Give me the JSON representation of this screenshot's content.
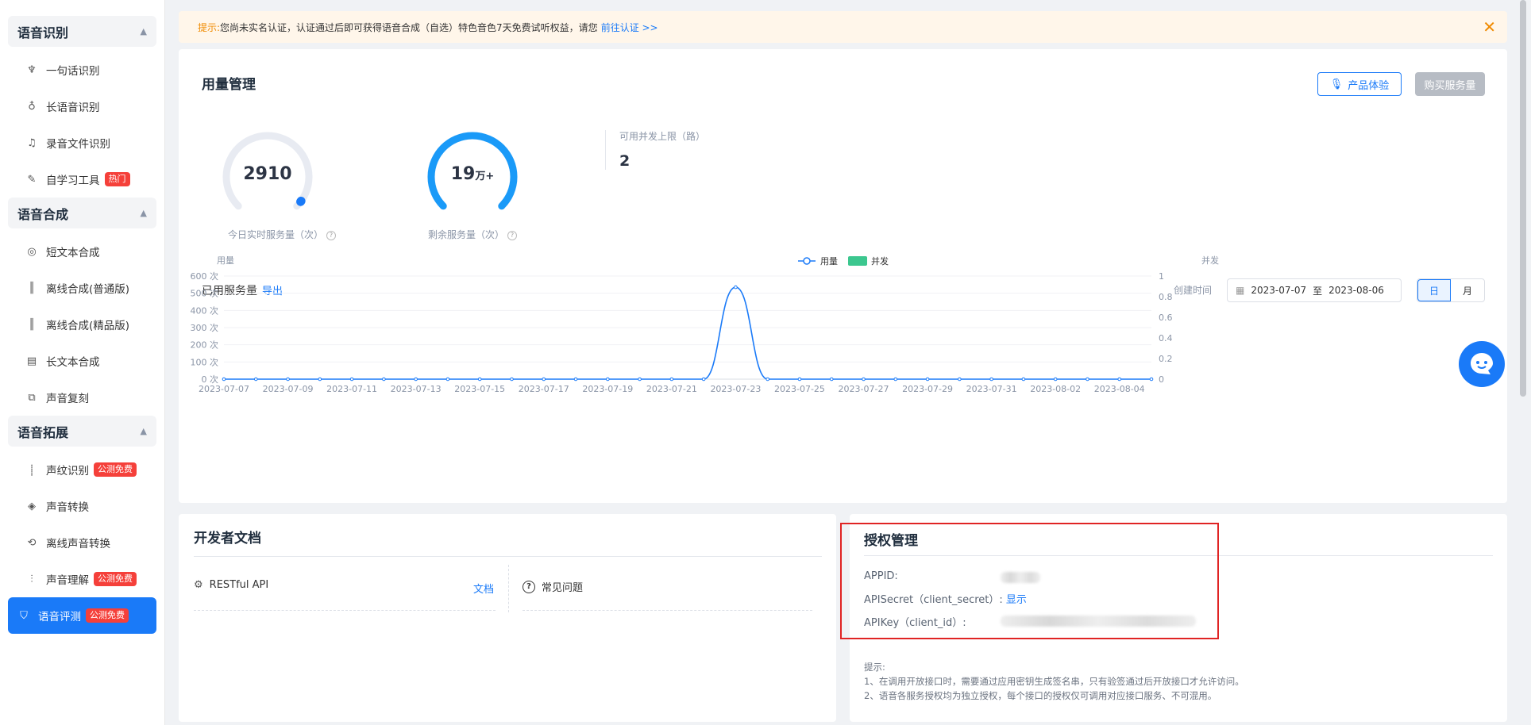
{
  "sidebar": {
    "groups": [
      {
        "title": "语音识别",
        "items": [
          {
            "label": "一句话识别",
            "icon": "mic-icon"
          },
          {
            "label": "长语音识别",
            "icon": "long-mic-icon"
          },
          {
            "label": "录音文件识别",
            "icon": "file-audio-icon"
          },
          {
            "label": "自学习工具",
            "icon": "edit-icon",
            "badge": "热门"
          }
        ]
      },
      {
        "title": "语音合成",
        "items": [
          {
            "label": "短文本合成",
            "icon": "synth-icon"
          },
          {
            "label": "离线合成(普通版)",
            "icon": "waveform-icon"
          },
          {
            "label": "离线合成(精品版)",
            "icon": "waveform-icon"
          },
          {
            "label": "长文本合成",
            "icon": "document-icon"
          },
          {
            "label": "声音复刻",
            "icon": "clone-icon"
          }
        ]
      },
      {
        "title": "语音拓展",
        "items": [
          {
            "label": "声纹识别",
            "icon": "voiceprint-icon",
            "badge": "公测免费"
          },
          {
            "label": "声音转换",
            "icon": "convert-icon"
          },
          {
            "label": "离线声音转换",
            "icon": "offline-convert-icon"
          },
          {
            "label": "声音理解",
            "icon": "understand-icon",
            "badge": "公测免费"
          },
          {
            "label": "语音评测",
            "icon": "shield-icon",
            "badge": "公测免费",
            "active": true
          }
        ]
      }
    ]
  },
  "notice": {
    "tip": "提示:",
    "text": "您尚未实名认证，认证通过后即可获得语音合成（自选）特色音色7天免费试听权益，请您",
    "link": "前往认证 >>"
  },
  "usage": {
    "title": "用量管理",
    "btn_try": "产品体验",
    "btn_buy": "购买服务量",
    "today_value": "2910",
    "today_label": "今日实时服务量（次）",
    "today_fraction": 0.97,
    "remaining_value": "19",
    "remaining_unit": "万+",
    "remaining_label": "剩余服务量（次）",
    "remaining_fraction": 1.0,
    "limit_label": "可用并发上限（路）",
    "limit_value": "2",
    "used_title": "已用服务量",
    "export": "导出",
    "date_label": "创建时间",
    "date_start": "2023-07-07",
    "date_sep": "至",
    "date_end": "2023-08-06",
    "seg_day": "日",
    "seg_month": "月"
  },
  "chart_data": {
    "type": "line",
    "ylabel_left": "用量",
    "ylabel_right": "并发",
    "legend": [
      "用量",
      "并发"
    ],
    "left_ticks": [
      "0 次",
      "100 次",
      "200 次",
      "300 次",
      "400 次",
      "500 次",
      "600 次"
    ],
    "right_ticks": [
      "0",
      "0.2",
      "0.4",
      "0.6",
      "0.8",
      "1"
    ],
    "ylim_left": [
      0,
      600
    ],
    "ylim_right": [
      0,
      1
    ],
    "x_tick_labels": [
      "2023-07-07",
      "2023-07-09",
      "2023-07-11",
      "2023-07-13",
      "2023-07-15",
      "2023-07-17",
      "2023-07-19",
      "2023-07-21",
      "2023-07-23",
      "2023-07-25",
      "2023-07-27",
      "2023-07-29",
      "2023-07-31",
      "2023-08-02",
      "2023-08-04"
    ],
    "x": [
      "2023-07-07",
      "2023-07-08",
      "2023-07-09",
      "2023-07-10",
      "2023-07-11",
      "2023-07-12",
      "2023-07-13",
      "2023-07-14",
      "2023-07-15",
      "2023-07-16",
      "2023-07-17",
      "2023-07-18",
      "2023-07-19",
      "2023-07-20",
      "2023-07-21",
      "2023-07-22",
      "2023-07-23",
      "2023-07-24",
      "2023-07-25",
      "2023-07-26",
      "2023-07-27",
      "2023-07-28",
      "2023-07-29",
      "2023-07-30",
      "2023-07-31",
      "2023-08-01",
      "2023-08-02",
      "2023-08-03",
      "2023-08-04",
      "2023-08-05"
    ],
    "series": [
      {
        "name": "用量",
        "color": "#1a7af8",
        "values": [
          0,
          0,
          0,
          0,
          0,
          0,
          0,
          0,
          0,
          0,
          0,
          0,
          0,
          0,
          0,
          0,
          535,
          0,
          0,
          0,
          0,
          0,
          0,
          0,
          0,
          0,
          0,
          0,
          0,
          0
        ]
      },
      {
        "name": "并发",
        "color": "#3cc78f",
        "values": []
      }
    ]
  },
  "devdocs": {
    "title": "开发者文档",
    "restful": "RESTful API",
    "doc_link": "文档",
    "faq": "常见问题"
  },
  "auth": {
    "title": "授权管理",
    "appid_label": "APPID:",
    "secret_label": "APISecret（client_secret）:",
    "show_link": "显示",
    "key_label": "APIKey（client_id）:",
    "hint_title": "提示:",
    "hint_1": "1、在调用开放接口时，需要通过应用密钥生成签名串，只有验签通过后开放接口才允许访问。",
    "hint_2": "2、语音各服务授权均为独立授权，每个接口的授权仅可调用对应接口服务、不可混用。"
  }
}
